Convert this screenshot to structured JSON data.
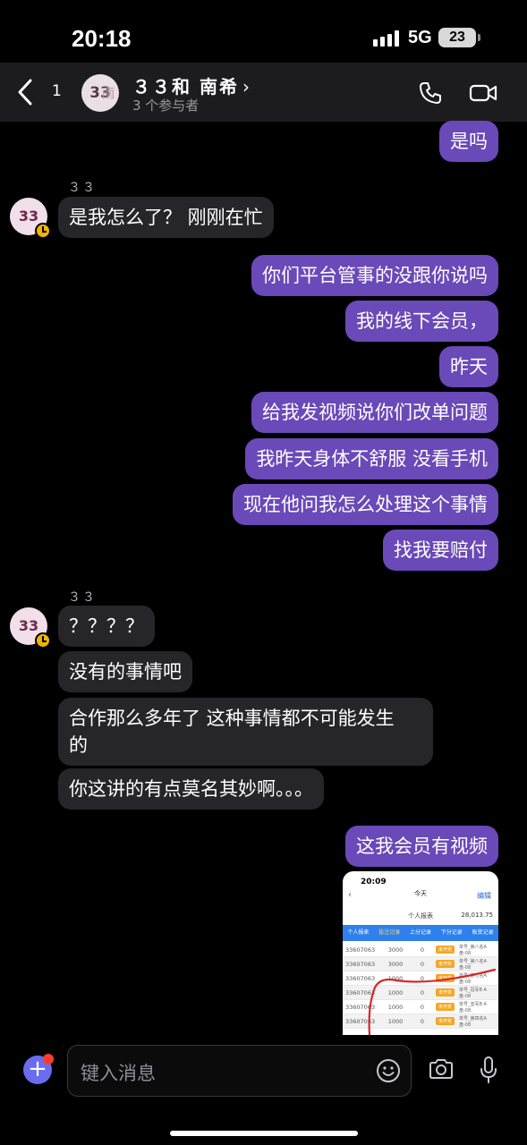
{
  "status_bar": {
    "time": "20:18",
    "network": "5G",
    "battery": "23"
  },
  "header": {
    "back_count": "1",
    "avatar_text": "33",
    "avatar_overlay": "南希",
    "title": "３３和 南希",
    "subtitle": "3 个参与者"
  },
  "messages": {
    "m1": "是吗",
    "sender1": "３３",
    "avatar1": "33",
    "m2": "是我怎么了？ 刚刚在忙",
    "m3": "你们平台管事的没跟你说吗",
    "m4": "我的线下会员，",
    "m5": "昨天",
    "m6": "给我发视频说你们改单问题",
    "m7": "我昨天身体不舒服 没看手机",
    "m8": "现在他问我怎么处理这个事情",
    "m9": "找我要赔付",
    "sender2": "３３",
    "avatar2": "33",
    "m10": "？？？？",
    "m11": "没有的事情吧",
    "m12_line1": "合作那么多年了 这种事情都不可能发生",
    "m12_line2": "的",
    "m13": "你这讲的有点莫名其妙啊。。。",
    "m14": "这我会员有视频"
  },
  "video_thumb": {
    "time": "20:09",
    "day": "今天",
    "edit": "编辑",
    "subtitle": "个人报表",
    "amount": "28,013.75",
    "tabs": [
      "个人报表",
      "投注记录",
      "上分记录",
      "下分记录",
      "账变记录"
    ],
    "rows": [
      {
        "id": "33607063",
        "amount": "3000",
        "win": "0",
        "tag": "未开奖",
        "note": "单号_第八名A盘-08"
      },
      {
        "id": "33607063",
        "amount": "3000",
        "win": "0",
        "tag": "未开奖",
        "note": "单号_第八名A盘-08"
      },
      {
        "id": "33607063",
        "amount": "1000",
        "win": "0",
        "tag": "未开奖",
        "note": "单号_第七名A盘-08"
      },
      {
        "id": "33607063",
        "amount": "1000",
        "win": "0",
        "tag": "未开奖",
        "note": "单号_冠军B A盘-08"
      },
      {
        "id": "33607063",
        "amount": "1000",
        "win": "0",
        "tag": "未开奖",
        "note": "单号_亚军B A盘-08"
      },
      {
        "id": "33607063",
        "amount": "1000",
        "win": "0",
        "tag": "未开奖",
        "note": "单号_第四名A盘-08"
      }
    ]
  },
  "composer": {
    "placeholder": "键入消息"
  },
  "colors": {
    "outgoing": "#6a49b8",
    "incoming": "#262628",
    "accent": "#6a6cf0"
  }
}
